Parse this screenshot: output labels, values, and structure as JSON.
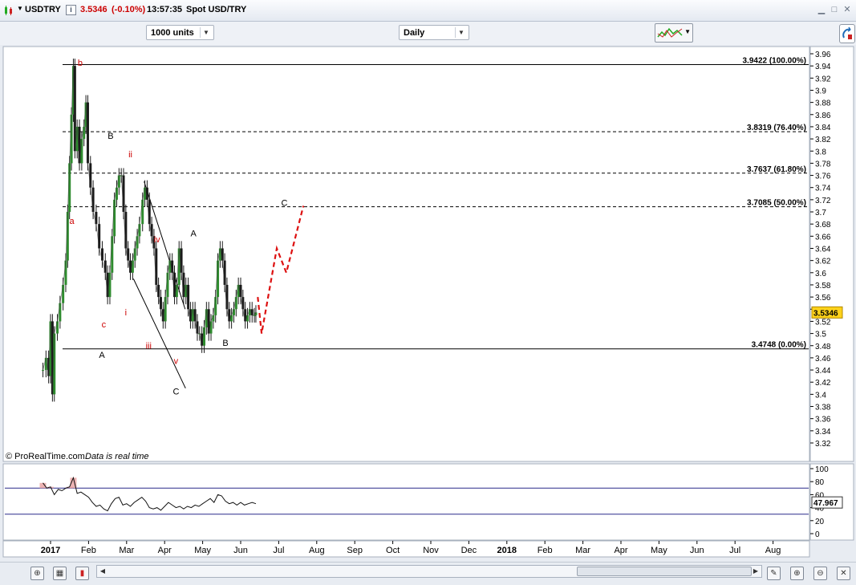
{
  "window": {
    "symbol": "USDTRY",
    "price": "3.5346",
    "change": "(-0.10%)",
    "time": "13:57:35",
    "instrument": "Spot USD/TRY"
  },
  "toolbar": {
    "units": "1000 units",
    "timeframe": "Daily"
  },
  "chart_data": {
    "type": "line",
    "price_axis": {
      "ylim": [
        3.31,
        3.97
      ],
      "ticks": [
        "3.96",
        "3.94",
        "3.92",
        "3.9",
        "3.88",
        "3.86",
        "3.84",
        "3.82",
        "3.8",
        "3.78",
        "3.76",
        "3.74",
        "3.72",
        "3.7",
        "3.68",
        "3.66",
        "3.64",
        "3.62",
        "3.6",
        "3.58",
        "3.56",
        "3.54",
        "3.52",
        "3.5",
        "3.48",
        "3.46",
        "3.44",
        "3.42",
        "3.4",
        "3.38",
        "3.36",
        "3.34",
        "3.32"
      ],
      "current_price": "3.5346"
    },
    "time_axis": {
      "labels": [
        {
          "label": "2017",
          "x": 0
        },
        {
          "label": "Feb",
          "x": 1
        },
        {
          "label": "Mar",
          "x": 2
        },
        {
          "label": "Apr",
          "x": 3
        },
        {
          "label": "May",
          "x": 4
        },
        {
          "label": "Jun",
          "x": 5
        },
        {
          "label": "Jul",
          "x": 6
        },
        {
          "label": "Aug",
          "x": 7
        },
        {
          "label": "Sep",
          "x": 8
        },
        {
          "label": "Oct",
          "x": 9
        },
        {
          "label": "Nov",
          "x": 10
        },
        {
          "label": "Dec",
          "x": 11
        },
        {
          "label": "2018",
          "x": 12
        },
        {
          "label": "Feb",
          "x": 13
        },
        {
          "label": "Mar",
          "x": 14
        },
        {
          "label": "Apr",
          "x": 15
        },
        {
          "label": "May",
          "x": 16
        },
        {
          "label": "Jun",
          "x": 17
        },
        {
          "label": "Jul",
          "x": 18
        },
        {
          "label": "Aug",
          "x": 19
        }
      ]
    },
    "fib_levels": [
      {
        "value": 3.9422,
        "label": "3.9422 (100.00%)",
        "style": "solid"
      },
      {
        "value": 3.8319,
        "label": "3.8319 (76.40%)",
        "style": "dashed"
      },
      {
        "value": 3.7637,
        "label": "3.7637 (61.80%)",
        "style": "dashed"
      },
      {
        "value": 3.7085,
        "label": "3.7085 (50.00%)",
        "style": "dashed"
      },
      {
        "value": 3.4748,
        "label": "3.4748 (0.00%)",
        "style": "solid"
      }
    ],
    "price_series": [
      [
        -0.2,
        3.44
      ],
      [
        -0.12,
        3.46
      ],
      [
        -0.05,
        3.43
      ],
      [
        0.0,
        3.52
      ],
      [
        0.05,
        3.4
      ],
      [
        0.1,
        3.5
      ],
      [
        0.18,
        3.52
      ],
      [
        0.25,
        3.55
      ],
      [
        0.33,
        3.58
      ],
      [
        0.4,
        3.62
      ],
      [
        0.45,
        3.7
      ],
      [
        0.5,
        3.78
      ],
      [
        0.55,
        3.86
      ],
      [
        0.6,
        3.94
      ],
      [
        0.64,
        3.8
      ],
      [
        0.7,
        3.84
      ],
      [
        0.76,
        3.78
      ],
      [
        0.82,
        3.82
      ],
      [
        0.88,
        3.84
      ],
      [
        0.93,
        3.88
      ],
      [
        0.98,
        3.78
      ],
      [
        1.05,
        3.74
      ],
      [
        1.12,
        3.7
      ],
      [
        1.2,
        3.68
      ],
      [
        1.28,
        3.64
      ],
      [
        1.36,
        3.62
      ],
      [
        1.44,
        3.6
      ],
      [
        1.5,
        3.56
      ],
      [
        1.56,
        3.6
      ],
      [
        1.62,
        3.66
      ],
      [
        1.68,
        3.72
      ],
      [
        1.74,
        3.74
      ],
      [
        1.8,
        3.76
      ],
      [
        1.86,
        3.76
      ],
      [
        1.92,
        3.7
      ],
      [
        1.98,
        3.64
      ],
      [
        2.04,
        3.62
      ],
      [
        2.1,
        3.6
      ],
      [
        2.16,
        3.62
      ],
      [
        2.22,
        3.64
      ],
      [
        2.28,
        3.66
      ],
      [
        2.34,
        3.68
      ],
      [
        2.42,
        3.72
      ],
      [
        2.48,
        3.74
      ],
      [
        2.54,
        3.72
      ],
      [
        2.6,
        3.68
      ],
      [
        2.66,
        3.66
      ],
      [
        2.72,
        3.64
      ],
      [
        2.78,
        3.58
      ],
      [
        2.84,
        3.56
      ],
      [
        2.9,
        3.54
      ],
      [
        2.96,
        3.52
      ],
      [
        3.02,
        3.56
      ],
      [
        3.08,
        3.6
      ],
      [
        3.14,
        3.62
      ],
      [
        3.2,
        3.6
      ],
      [
        3.26,
        3.56
      ],
      [
        3.32,
        3.58
      ],
      [
        3.38,
        3.64
      ],
      [
        3.44,
        3.6
      ],
      [
        3.5,
        3.56
      ],
      [
        3.56,
        3.58
      ],
      [
        3.62,
        3.54
      ],
      [
        3.68,
        3.52
      ],
      [
        3.74,
        3.54
      ],
      [
        3.8,
        3.52
      ],
      [
        3.86,
        3.5
      ],
      [
        3.92,
        3.5
      ],
      [
        3.98,
        3.48
      ],
      [
        4.04,
        3.51
      ],
      [
        4.1,
        3.54
      ],
      [
        4.16,
        3.5
      ],
      [
        4.22,
        3.52
      ],
      [
        4.28,
        3.53
      ],
      [
        4.34,
        3.56
      ],
      [
        4.4,
        3.62
      ],
      [
        4.46,
        3.64
      ],
      [
        4.52,
        3.62
      ],
      [
        4.58,
        3.58
      ],
      [
        4.64,
        3.54
      ],
      [
        4.7,
        3.52
      ],
      [
        4.76,
        3.53
      ],
      [
        4.82,
        3.54
      ],
      [
        4.88,
        3.56
      ],
      [
        4.94,
        3.58
      ],
      [
        5.0,
        3.56
      ],
      [
        5.06,
        3.54
      ],
      [
        5.12,
        3.52
      ],
      [
        5.18,
        3.53
      ],
      [
        5.24,
        3.54
      ],
      [
        5.3,
        3.53
      ],
      [
        5.36,
        3.53
      ],
      [
        5.4,
        3.5346
      ]
    ],
    "forecast_path": [
      [
        5.45,
        3.56
      ],
      [
        5.55,
        3.5
      ],
      [
        5.95,
        3.64
      ],
      [
        6.2,
        3.6
      ],
      [
        6.65,
        3.71
      ]
    ],
    "channel_lines": [
      [
        [
          2.46,
          3.75
        ],
        [
          3.54,
          3.54
        ]
      ],
      [
        [
          2.18,
          3.59
        ],
        [
          3.55,
          3.41
        ]
      ]
    ],
    "wave_labels": [
      {
        "text": "b",
        "x": 0.78,
        "y": 3.94,
        "color": "#cc0000"
      },
      {
        "text": "a",
        "x": 0.56,
        "y": 3.68,
        "color": "#cc0000"
      },
      {
        "text": "c",
        "x": 1.4,
        "y": 3.51,
        "color": "#cc0000"
      },
      {
        "text": "B",
        "x": 1.58,
        "y": 3.82,
        "color": "#000000"
      },
      {
        "text": "ii",
        "x": 2.1,
        "y": 3.79,
        "color": "#cc0000"
      },
      {
        "text": "i",
        "x": 1.98,
        "y": 3.53,
        "color": "#cc0000"
      },
      {
        "text": "A",
        "x": 1.35,
        "y": 3.46,
        "color": "#000000"
      },
      {
        "text": "iii",
        "x": 2.58,
        "y": 3.475,
        "color": "#cc0000"
      },
      {
        "text": "iv",
        "x": 2.8,
        "y": 3.65,
        "color": "#cc0000"
      },
      {
        "text": "v",
        "x": 3.3,
        "y": 3.45,
        "color": "#cc0000"
      },
      {
        "text": "C",
        "x": 3.3,
        "y": 3.4,
        "color": "#000000"
      },
      {
        "text": "A",
        "x": 3.76,
        "y": 3.66,
        "color": "#000000"
      },
      {
        "text": "B",
        "x": 4.6,
        "y": 3.48,
        "color": "#000000"
      },
      {
        "text": "C",
        "x": 6.15,
        "y": 3.71,
        "color": "#000000"
      }
    ],
    "indicator": {
      "ylim": [
        -3,
        105
      ],
      "ticks": [
        "100",
        "80",
        "60",
        "40",
        "20",
        "0"
      ],
      "upper_level": 70,
      "lower_level": 30,
      "current_value": "47.967",
      "values": [
        [
          -0.2,
          78
        ],
        [
          -0.1,
          70
        ],
        [
          0.0,
          72
        ],
        [
          0.1,
          60
        ],
        [
          0.2,
          68
        ],
        [
          0.3,
          66
        ],
        [
          0.4,
          70
        ],
        [
          0.5,
          72
        ],
        [
          0.6,
          86
        ],
        [
          0.7,
          62
        ],
        [
          0.8,
          64
        ],
        [
          0.9,
          60
        ],
        [
          1.0,
          56
        ],
        [
          1.1,
          48
        ],
        [
          1.2,
          42
        ],
        [
          1.3,
          44
        ],
        [
          1.4,
          38
        ],
        [
          1.5,
          35
        ],
        [
          1.6,
          46
        ],
        [
          1.7,
          54
        ],
        [
          1.8,
          56
        ],
        [
          1.9,
          44
        ],
        [
          2.0,
          46
        ],
        [
          2.1,
          42
        ],
        [
          2.2,
          48
        ],
        [
          2.3,
          52
        ],
        [
          2.4,
          56
        ],
        [
          2.5,
          50
        ],
        [
          2.6,
          40
        ],
        [
          2.7,
          38
        ],
        [
          2.8,
          40
        ],
        [
          2.9,
          36
        ],
        [
          3.0,
          42
        ],
        [
          3.1,
          48
        ],
        [
          3.2,
          44
        ],
        [
          3.3,
          40
        ],
        [
          3.4,
          42
        ],
        [
          3.5,
          38
        ],
        [
          3.6,
          42
        ],
        [
          3.7,
          40
        ],
        [
          3.8,
          44
        ],
        [
          3.9,
          42
        ],
        [
          4.0,
          46
        ],
        [
          4.1,
          50
        ],
        [
          4.2,
          54
        ],
        [
          4.3,
          48
        ],
        [
          4.4,
          60
        ],
        [
          4.5,
          58
        ],
        [
          4.6,
          50
        ],
        [
          4.7,
          46
        ],
        [
          4.8,
          48
        ],
        [
          4.9,
          44
        ],
        [
          5.0,
          48
        ],
        [
          5.1,
          44
        ],
        [
          5.2,
          46
        ],
        [
          5.3,
          48
        ],
        [
          5.4,
          46
        ]
      ]
    }
  },
  "footer": {
    "brand": "© ProRealTime.com",
    "status": "Data is real time"
  },
  "icons": {
    "title": "candlestick-icon",
    "info": "info-icon",
    "scroll_left": "arrow-left-icon",
    "scroll_right": "arrow-right-icon"
  }
}
